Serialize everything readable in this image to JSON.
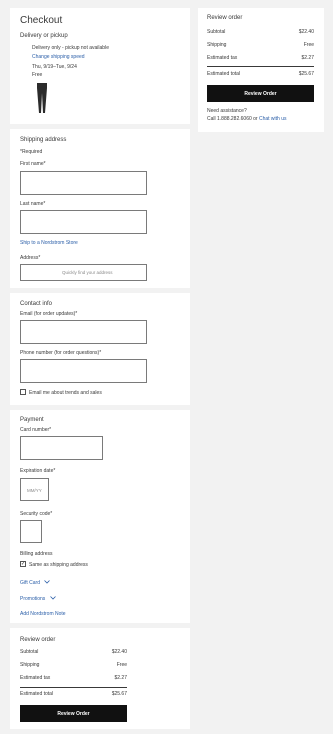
{
  "checkout": {
    "title": "Checkout",
    "delivery_heading": "Delivery or pickup",
    "delivery_note": "Delivery only - pickup not available",
    "change_speed": "Change shipping speed",
    "date_range": "Thu, 9/19–Tue, 9/24",
    "shipping_price": "Free"
  },
  "shipping": {
    "heading": "Shipping address",
    "required": "*Required",
    "first_name_label": "First name*",
    "last_name_label": "Last name*",
    "store_link": "Ship to a Nordstrom Store",
    "address_label": "Address*",
    "address_placeholder": "Quickly find your address"
  },
  "contact": {
    "heading": "Contact info",
    "email_label": "Email (for order updates)*",
    "phone_label": "Phone number (for order questions)*",
    "trends_label": "Email me about trends and sales",
    "trends_checked": false
  },
  "payment": {
    "heading": "Payment",
    "card_label": "Card number*",
    "expiry_label": "Expiration date*",
    "expiry_placeholder": "MM/YY",
    "security_label": "Security code*",
    "billing_heading": "Billing address",
    "same_as_shipping": "Same as shipping address",
    "same_checked": true,
    "gift_card": "Gift Card",
    "promotions": "Promotions",
    "nordstrom_note": "Add Nordstrom Note"
  },
  "summary": {
    "heading": "Review order",
    "subtotal_label": "Subtotal",
    "subtotal_value": "$22.40",
    "shipping_label": "Shipping",
    "shipping_value": "Free",
    "tax_label": "Estimated tax",
    "tax_value": "$2.27",
    "total_label": "Estimated total",
    "total_value": "$25.67",
    "button_label": "Review Order",
    "assist_heading": "Need assistance?",
    "assist_call": "Call 1.888.282.6060 or",
    "assist_chat": "Chat with us"
  },
  "colors": {
    "link": "#2a5ea8",
    "button": "#111111",
    "background": "#f2f2f2"
  },
  "icons": {
    "chevron": "chevron-down-icon",
    "check": "checkmark-icon"
  }
}
